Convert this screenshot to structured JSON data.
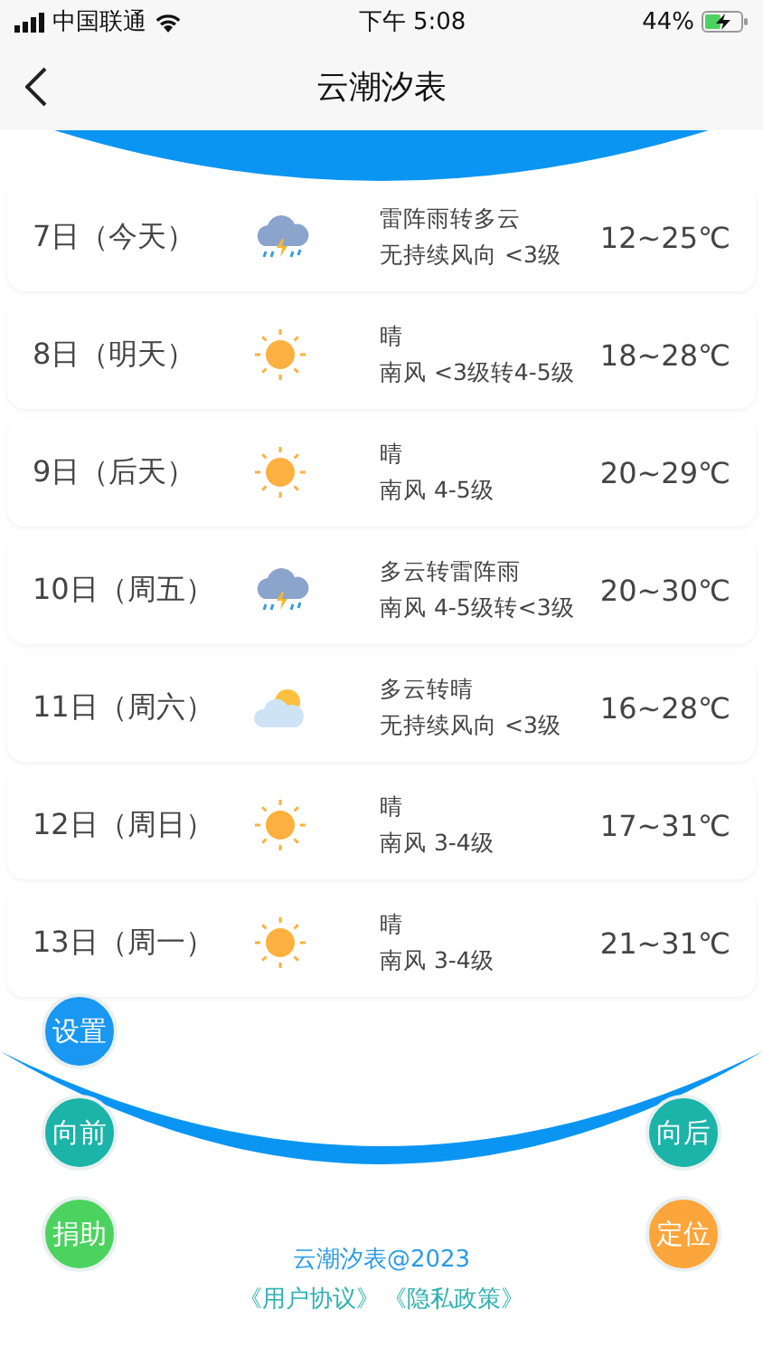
{
  "status_bar": {
    "carrier": "中国联通",
    "time": "下午 5:08",
    "battery": "44%",
    "charging": true
  },
  "nav": {
    "title": "云潮汐表"
  },
  "days": [
    {
      "date": "7日（今天）",
      "kind": "thunder-rain",
      "weather": "雷阵雨转多云",
      "wind": "无持续风向 <3级",
      "temp": "12~25℃"
    },
    {
      "date": "8日（明天）",
      "kind": "sunny",
      "weather": "晴",
      "wind": "南风 <3级转4-5级",
      "temp": "18~28℃"
    },
    {
      "date": "9日（后天）",
      "kind": "sunny",
      "weather": "晴",
      "wind": "南风 4-5级",
      "temp": "20~29℃"
    },
    {
      "date": "10日（周五）",
      "kind": "thunder-rain",
      "weather": "多云转雷阵雨",
      "wind": "南风 4-5级转<3级",
      "temp": "20~30℃"
    },
    {
      "date": "11日（周六）",
      "kind": "cloudy-sunny",
      "weather": "多云转晴",
      "wind": "无持续风向 <3级",
      "temp": "16~28℃"
    },
    {
      "date": "12日（周日）",
      "kind": "sunny",
      "weather": "晴",
      "wind": "南风 3-4级",
      "temp": "17~31℃"
    },
    {
      "date": "13日（周一）",
      "kind": "sunny",
      "weather": "晴",
      "wind": "南风 3-4级",
      "temp": "21~31℃"
    }
  ],
  "action_rows": [
    {
      "left": {
        "label": "设置",
        "color": "#1a97f0"
      }
    },
    {
      "left": {
        "label": "向前",
        "color": "#1cb3a8"
      },
      "right": {
        "label": "向后",
        "color": "#1cb3a8"
      }
    },
    {
      "left": {
        "label": "捐助",
        "color": "#4cd35f"
      },
      "right": {
        "label": "定位",
        "color": "#fba53a"
      }
    }
  ],
  "footer": {
    "copyright": "云潮汐表@2023",
    "links": [
      "《用户协议》",
      "《隐私政策》"
    ]
  }
}
